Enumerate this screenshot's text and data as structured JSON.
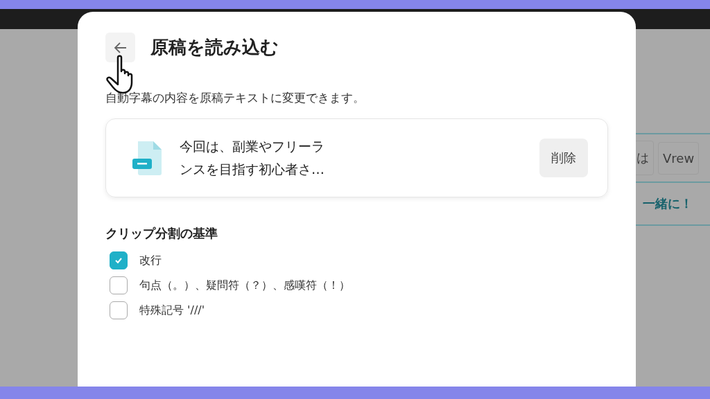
{
  "background": {
    "chips": [
      "は",
      "Vrew"
    ],
    "caption": "一緒に！"
  },
  "dialog": {
    "title": "原稿を読み込む",
    "description": "自動字幕の内容を原稿テキストに変更できます。",
    "file": {
      "preview": "今回は、副業やフリーランスを目指す初心者さ…",
      "delete_label": "削除"
    },
    "section_title": "クリップ分割の基準",
    "options": [
      {
        "label": "改行",
        "checked": true
      },
      {
        "label": "句点（。）、疑問符（？）、感嘆符（！）",
        "checked": false
      },
      {
        "label": "特殊記号 '///'",
        "checked": false
      }
    ]
  }
}
